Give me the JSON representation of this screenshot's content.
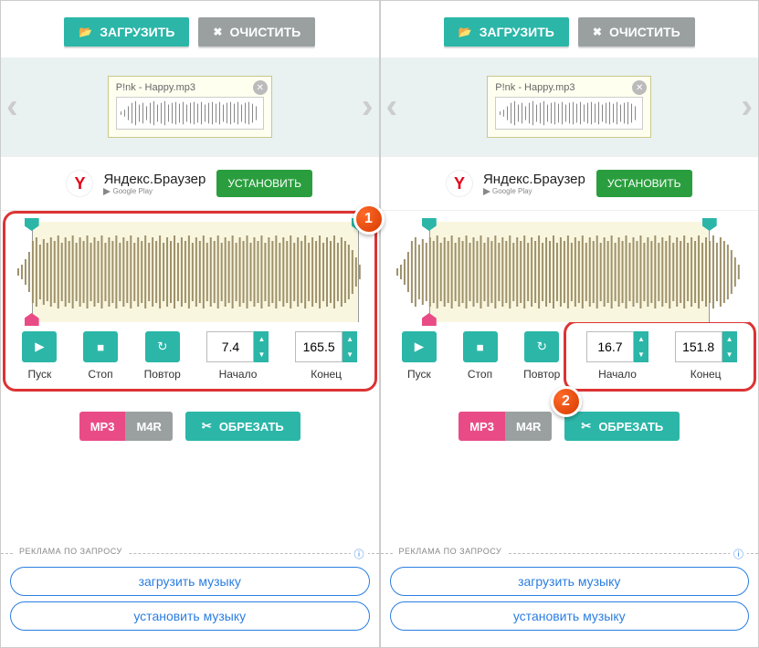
{
  "toolbar": {
    "load": "ЗАГРУЗИТЬ",
    "clear": "ОЧИСТИТЬ"
  },
  "file": {
    "name": "P!nk - Happy.mp3"
  },
  "ad_top": {
    "title": "Яндекс.Браузер",
    "store": "Google Play",
    "cta": "УСТАНОВИТЬ"
  },
  "controls": {
    "play": "Пуск",
    "stop": "Стоп",
    "repeat": "Повтор",
    "start": "Начало",
    "end": "Конец"
  },
  "fmt": {
    "mp3": "MP3",
    "m4r": "M4R",
    "cut": "ОБРЕЗАТЬ"
  },
  "ad_bottom": {
    "label": "РЕКЛАМА ПО ЗАПРОСУ",
    "link1": "загрузить музыку",
    "link2": "установить музыку"
  },
  "pane_left": {
    "start": "7.4",
    "end": "165.5",
    "sel_from_pct": 6,
    "sel_to_pct": 97,
    "badge": "1"
  },
  "pane_right": {
    "start": "16.7",
    "end": "151.8",
    "sel_from_pct": 11,
    "sel_to_pct": 89,
    "badge": "2"
  }
}
